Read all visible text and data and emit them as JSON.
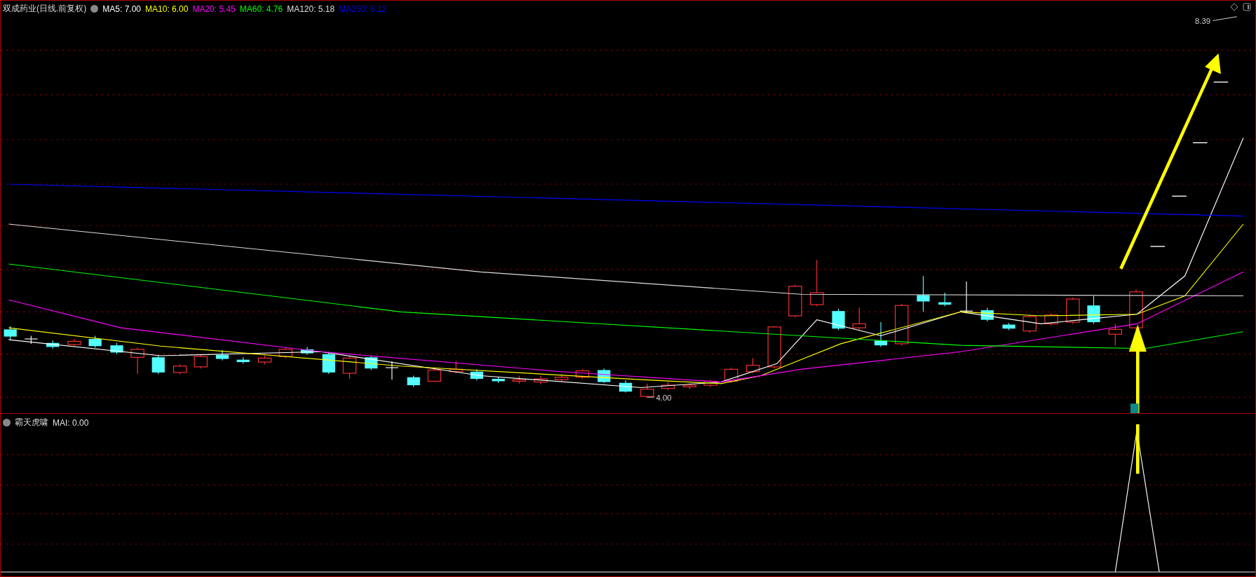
{
  "chart_header": {
    "title": "双成药业(日线.前复权)",
    "moving_averages": [
      {
        "label": "MA5: 7.00",
        "color": "#ffffff"
      },
      {
        "label": "MA10: 6.00",
        "color": "#ffff00"
      },
      {
        "label": "MA20: 5.45",
        "color": "#ff00ff"
      },
      {
        "label": "MA60: 4.76",
        "color": "#00ff00"
      },
      {
        "label": "MA120: 5.18",
        "color": "#dddddd"
      },
      {
        "label": "MA250: 6.12",
        "color": "#0000ff"
      }
    ]
  },
  "price_labels": {
    "high": "8.39",
    "low": "4.00"
  },
  "indicator_panel": {
    "name": "霸天虎啸",
    "reading": "MAI: 0.00"
  }
}
